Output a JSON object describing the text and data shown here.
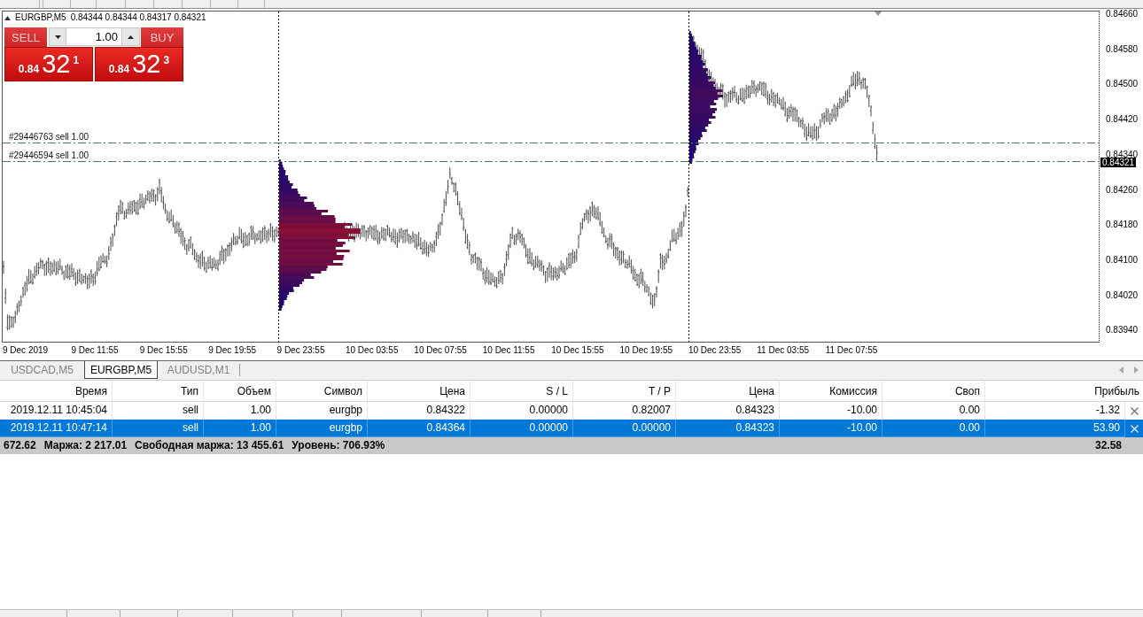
{
  "chart": {
    "header": {
      "symbol": "EURGBP,M5",
      "prices": "0.84344 0.84344 0.84317 0.84321"
    },
    "trade_panel": {
      "sell_label": "SELL",
      "volume": "1.00",
      "buy_label": "BUY",
      "sell_price": {
        "prefix": "0.84",
        "big": "32",
        "pip": "1"
      },
      "buy_price": {
        "prefix": "0.84",
        "big": "32",
        "pip": "3"
      }
    },
    "order_lines": [
      {
        "label": "#29446763 sell 1.00"
      },
      {
        "label": "#29446594 sell 1.00"
      }
    ],
    "price_axis": [
      "0.84660",
      "0.84580",
      "0.84500",
      "0.84420",
      "0.84340",
      "0.84260",
      "0.84180",
      "0.84100",
      "0.84020",
      "0.83940"
    ],
    "current_price": "0.84321",
    "time_axis": [
      "9 Dec 2019",
      "9 Dec 11:55",
      "9 Dec 15:55",
      "9 Dec 19:55",
      "9 Dec 23:55",
      "10 Dec 03:55",
      "10 Dec 07:55",
      "10 Dec 11:55",
      "10 Dec 15:55",
      "10 Dec 19:55",
      "10 Dec 23:55",
      "11 Dec 03:55",
      "11 Dec 07:55"
    ]
  },
  "chart_tabs": [
    {
      "label": "USDCAD,M5",
      "selected": false
    },
    {
      "label": "EURGBP,M5",
      "selected": true
    },
    {
      "label": "AUDUSD,M1",
      "selected": false
    }
  ],
  "terminal": {
    "columns": [
      "Время",
      "Тип",
      "Объем",
      "Символ",
      "Цена",
      "S / L",
      "T / P",
      "Цена",
      "Комиссия",
      "Своп",
      "Прибыль"
    ],
    "rows": [
      {
        "cells": [
          "2019.12.11 10:45:04",
          "sell",
          "1.00",
          "eurgbp",
          "0.84322",
          "0.00000",
          "0.82007",
          "0.84323",
          "-10.00",
          "0.00",
          "-1.32"
        ],
        "selected": false
      },
      {
        "cells": [
          "2019.12.11 10:47:14",
          "sell",
          "1.00",
          "eurgbp",
          "0.84364",
          "0.00000",
          "0.00000",
          "0.84323",
          "-10.00",
          "0.00",
          "53.90"
        ],
        "selected": true
      }
    ],
    "summary": {
      "items": [
        "672.62",
        "Маржа: 2 217.01",
        "Свободная маржа: 13 455.61",
        "Уровень: 706.93%"
      ],
      "profit": "32.58"
    }
  }
}
